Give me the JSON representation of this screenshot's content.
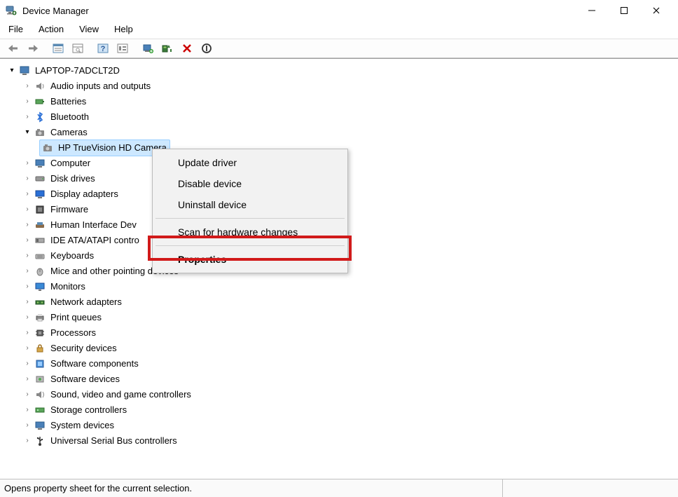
{
  "window": {
    "title": "Device Manager",
    "controls": {
      "min": "–",
      "max": "▢",
      "close": "✕"
    }
  },
  "menu": {
    "file": "File",
    "action": "Action",
    "view": "View",
    "help": "Help"
  },
  "tree": {
    "root": "LAPTOP-7ADCLT2D",
    "audio": "Audio inputs and outputs",
    "batteries": "Batteries",
    "bluetooth": "Bluetooth",
    "cameras": "Cameras",
    "camera_child": "HP TrueVision HD Camera",
    "computer": "Computer",
    "disk": "Disk drives",
    "display": "Display adapters",
    "firmware": "Firmware",
    "hid": "Human Interface Dev",
    "ide": "IDE ATA/ATAPI contro",
    "keyboards": "Keyboards",
    "mice": "Mice and other pointing devices",
    "monitors": "Monitors",
    "network": "Network adapters",
    "print": "Print queues",
    "processors": "Processors",
    "security": "Security devices",
    "softcomp": "Software components",
    "softdev": "Software devices",
    "sound": "Sound, video and game controllers",
    "storage": "Storage controllers",
    "system": "System devices",
    "usb": "Universal Serial Bus controllers"
  },
  "context_menu": {
    "update": "Update driver",
    "disable": "Disable device",
    "uninstall": "Uninstall device",
    "scan": "Scan for hardware changes",
    "properties": "Properties"
  },
  "status": "Opens property sheet for the current selection."
}
